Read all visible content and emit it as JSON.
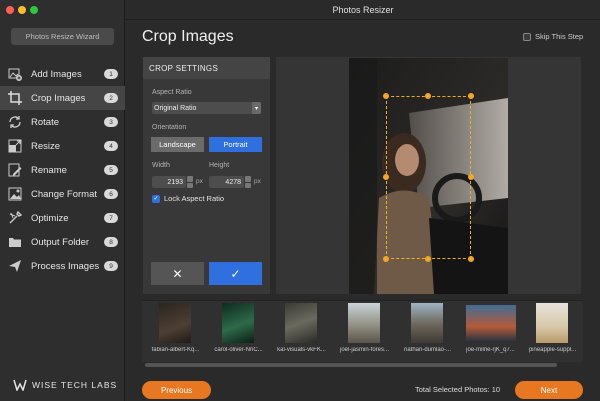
{
  "window": {
    "title": "Photos Resizer"
  },
  "sidebar": {
    "wizard_label": "Photos Resize Wizard",
    "items": [
      {
        "label": "Add Images",
        "badge": "1",
        "icon": "add-images-icon"
      },
      {
        "label": "Crop Images",
        "badge": "2",
        "icon": "crop-icon"
      },
      {
        "label": "Rotate",
        "badge": "3",
        "icon": "rotate-icon"
      },
      {
        "label": "Resize",
        "badge": "4",
        "icon": "resize-icon"
      },
      {
        "label": "Rename",
        "badge": "5",
        "icon": "rename-icon"
      },
      {
        "label": "Change Format",
        "badge": "6",
        "icon": "change-format-icon"
      },
      {
        "label": "Optimize",
        "badge": "7",
        "icon": "optimize-icon"
      },
      {
        "label": "Output Folder",
        "badge": "8",
        "icon": "folder-icon"
      },
      {
        "label": "Process Images",
        "badge": "9",
        "icon": "process-icon"
      }
    ],
    "active_index": 1,
    "logo_text": "WISE TECH LABS"
  },
  "main": {
    "title": "Crop Images",
    "skip_label": "Skip This Step"
  },
  "crop_settings": {
    "header": "CROP SETTINGS",
    "aspect_label": "Aspect Ratio",
    "aspect_value": "Original Ratio",
    "orientation_label": "Orientation",
    "landscape_label": "Landscape",
    "portrait_label": "Portrait",
    "width_label": "Width",
    "height_label": "Height",
    "width_value": "2193",
    "height_value": "4278",
    "unit": "px",
    "lock_label": "Lock Aspect Ratio",
    "cancel_symbol": "✕",
    "confirm_symbol": "✓"
  },
  "thumbnails": [
    {
      "caption": "fabian-albert-Kq..."
    },
    {
      "caption": "carol-oliver-NnC..."
    },
    {
      "caption": "kal-visuals-vkFK..."
    },
    {
      "caption": "joel-jasmin-fores..."
    },
    {
      "caption": "nathan-dumlao-..."
    },
    {
      "caption": "joe-milne-rjK_q7..."
    },
    {
      "caption": "pineapple-suppl..."
    }
  ],
  "footer": {
    "previous_label": "Previous",
    "total_label": "Total Selected Photos: 10",
    "next_label": "Next"
  },
  "colors": {
    "accent_orange": "#e87722",
    "accent_blue": "#2f6fe0",
    "crop_handle": "#f5a623"
  }
}
